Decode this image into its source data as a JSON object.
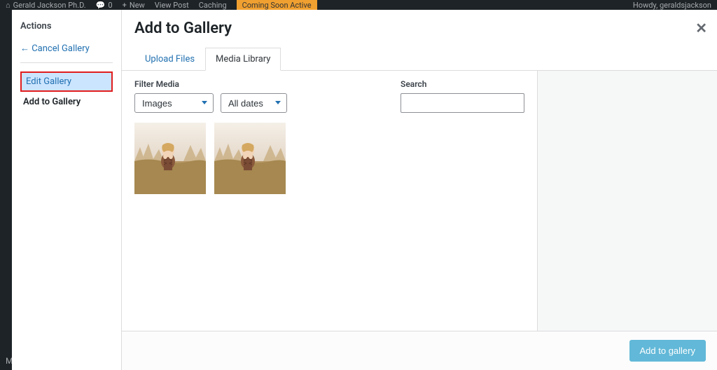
{
  "admin_bar": {
    "site_name": "Gerald Jackson Ph.D.",
    "comments": "0",
    "new_label": "New",
    "view_post": "View Post",
    "caching": "Caching",
    "coming_soon": "Coming Soon Active",
    "howdy": "Howdy, geraldsjackson"
  },
  "bg_menu": {
    "meow": "Meow Apps"
  },
  "sidebar": {
    "heading": "Actions",
    "cancel": "← Cancel Gallery",
    "edit": "Edit Gallery",
    "add": "Add to Gallery"
  },
  "modal": {
    "title": "Add to Gallery",
    "tabs": {
      "upload": "Upload Files",
      "library": "Media Library"
    },
    "filter_label": "Filter Media",
    "select_type": "Images",
    "select_dates": "All dates",
    "search_label": "Search",
    "search_value": "",
    "submit": "Add to gallery"
  }
}
